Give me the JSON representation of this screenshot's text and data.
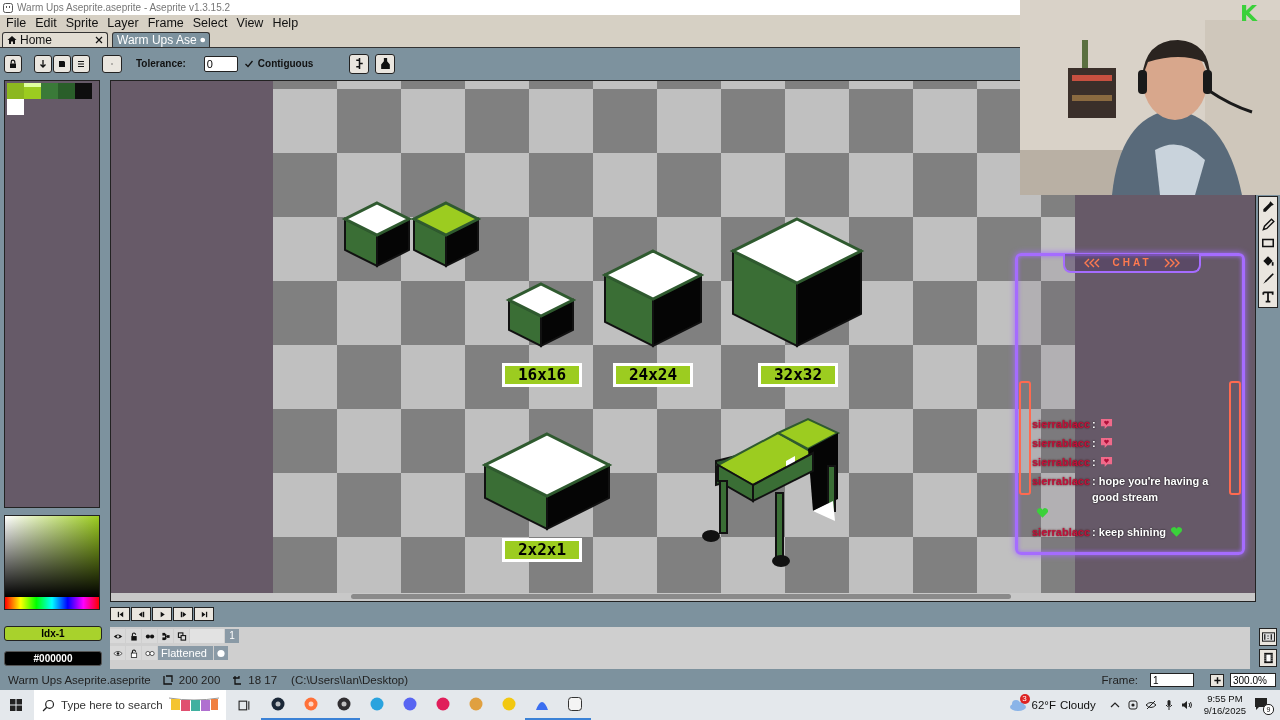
{
  "window": {
    "title": "Warm Ups Aseprite.aseprite - Aseprite v1.3.15.2"
  },
  "menu": [
    "File",
    "Edit",
    "Sprite",
    "Layer",
    "Frame",
    "Select",
    "View",
    "Help"
  ],
  "tabs": [
    {
      "label": "Home",
      "kind": "home",
      "selected": false
    },
    {
      "label": "Warm Ups Ase",
      "kind": "document",
      "selected": true
    }
  ],
  "toolbar": {
    "tolerance_label": "Tolerance:",
    "tolerance": "0",
    "contiguous": {
      "label": "Contiguous",
      "checked": true
    }
  },
  "palette": {
    "swatches": [
      {
        "color": "#8cb820",
        "selected": false
      },
      {
        "color": "#9ccc20",
        "selected": true
      },
      {
        "color": "#3a7a38",
        "selected": false
      },
      {
        "color": "#2a5e2a",
        "selected": false
      },
      {
        "color": "#0e0e0e",
        "selected": false
      },
      {
        "color": "#ffffff",
        "selected": false
      }
    ]
  },
  "color_bar": {
    "index_label": "Idx-1",
    "hex": "#000000"
  },
  "canvas": {
    "labels": [
      "16x16",
      "24x24",
      "32x32",
      "2x2x1"
    ]
  },
  "timeline": {
    "frame_header": "1",
    "layers": [
      {
        "name": "Flattened"
      }
    ]
  },
  "status_bar": {
    "file": "Warm Ups Aseprite.aseprite",
    "size": "200 200",
    "position": "18 17",
    "path": "(C:\\Users\\Ian\\Desktop)",
    "frame_label": "Frame:",
    "frame": "1",
    "zoom": "300.0%"
  },
  "chat": {
    "title": "CHAT",
    "messages": [
      {
        "user": "sierrablacc",
        "text": ":",
        "kind": "bubble"
      },
      {
        "user": "sierrablacc",
        "text": ":",
        "kind": "bubble"
      },
      {
        "user": "sierrablacc",
        "text": ":",
        "kind": "bubble"
      },
      {
        "user": "sierrablacc",
        "text": ": hope you're having a good stream",
        "kind": "heart"
      },
      {
        "user": "sierrablacc",
        "text": ": keep shining",
        "kind": "heart"
      }
    ]
  },
  "stream_logo": "K",
  "taskbar": {
    "search_placeholder": "Type here to search",
    "apps": [
      {
        "kind": "steam",
        "running": true
      },
      {
        "kind": "firefox",
        "running": true
      },
      {
        "kind": "obs",
        "running": true
      },
      {
        "kind": "telegram",
        "running": false
      },
      {
        "kind": "discord",
        "running": false
      },
      {
        "kind": "slack",
        "running": false
      },
      {
        "kind": "bird",
        "running": false
      },
      {
        "kind": "yellow",
        "running": false
      },
      {
        "kind": "arc",
        "running": true
      },
      {
        "kind": "aseprite",
        "running": true
      }
    ],
    "weather": {
      "badge": "3",
      "temp": "62°F",
      "condition": "Cloudy"
    },
    "time": "9:55 PM",
    "date": "9/16/2025",
    "notifications": "9"
  }
}
